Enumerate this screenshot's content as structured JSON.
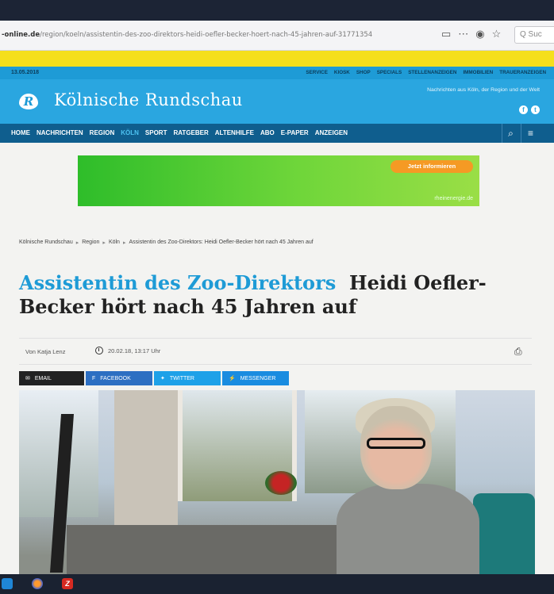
{
  "browser": {
    "url_domain": "-online.de",
    "url_path": "/region/koeln/assistentin-des-zoo-direktors-heidi-oefler-becker-hoert-nach-45-jahren-auf-31771354",
    "search_placeholder": "Q Suc"
  },
  "site": {
    "date": "13.05.2018",
    "top_links": [
      "SERVICE",
      "KIOSK",
      "SHOP",
      "SPECIALS",
      "STELLENANZEIGEN",
      "IMMOBILIEN",
      "TRAUERANZEIGEN"
    ],
    "logo_letter": "R",
    "logo_name": "Kölnische Rundschau",
    "tagline": "Nachrichten aus Köln, der Region und der Welt",
    "nav": [
      "HOME",
      "NACHRICHTEN",
      "REGION",
      "KÖLN",
      "SPORT",
      "RATGEBER",
      "ALTENHILFE",
      "ABO",
      "E-PAPER",
      "ANZEIGEN"
    ],
    "nav_active": "KÖLN"
  },
  "ad": {
    "button": "Jetzt informieren",
    "brand": "rheinenergie.de"
  },
  "breadcrumb": [
    "Kölnische Rundschau",
    "Region",
    "Köln",
    "Assistentin des Zoo-Direktors: Heidi Oefler-Becker hört nach 45 Jahren auf"
  ],
  "article": {
    "kicker": "Assistentin des Zoo-Direktors",
    "title": "Heidi Oefler-Becker hört nach 45 Jahren auf",
    "author": "Von Katja Lenz",
    "date": "20.02.18, 13:17 Uhr"
  },
  "share": {
    "email": "EMAIL",
    "facebook": "FACEBOOK",
    "twitter": "TWITTER",
    "messenger": "MESSENGER"
  }
}
